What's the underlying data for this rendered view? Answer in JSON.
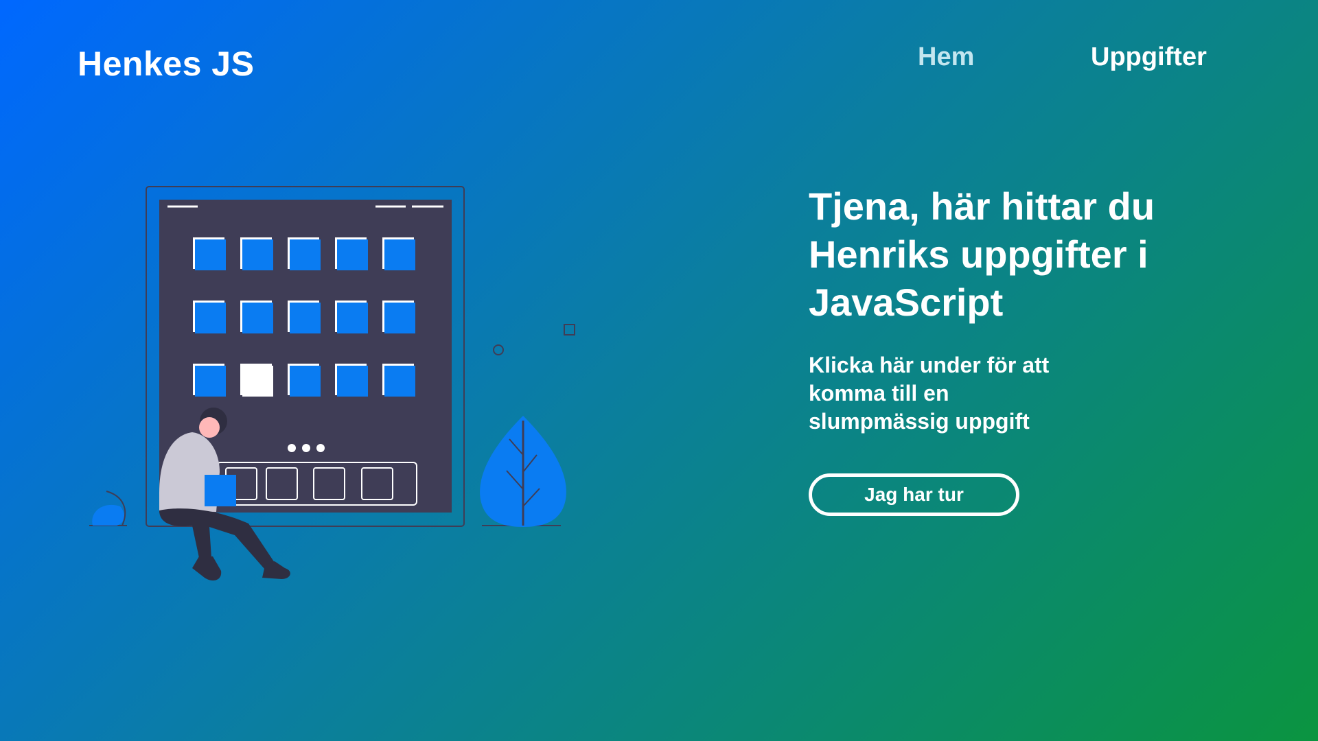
{
  "header": {
    "logo": "Henkes JS",
    "nav": [
      {
        "label": "Hem"
      },
      {
        "label": "Uppgifter"
      }
    ]
  },
  "hero": {
    "title": "Tjena, här hittar du Henriks uppgifter i JavaScript",
    "subtitle": "Klicka här under för att komma till en slumpmässig uppgift",
    "cta_label": "Jag har tur"
  },
  "colors": {
    "gradient_start": "#0068ff",
    "gradient_end": "#0b9440",
    "tile_blue": "#0a7cf2",
    "screen_dark": "#3f3d56"
  },
  "illustration": {
    "icon": "person-with-app-grid-illustration"
  }
}
